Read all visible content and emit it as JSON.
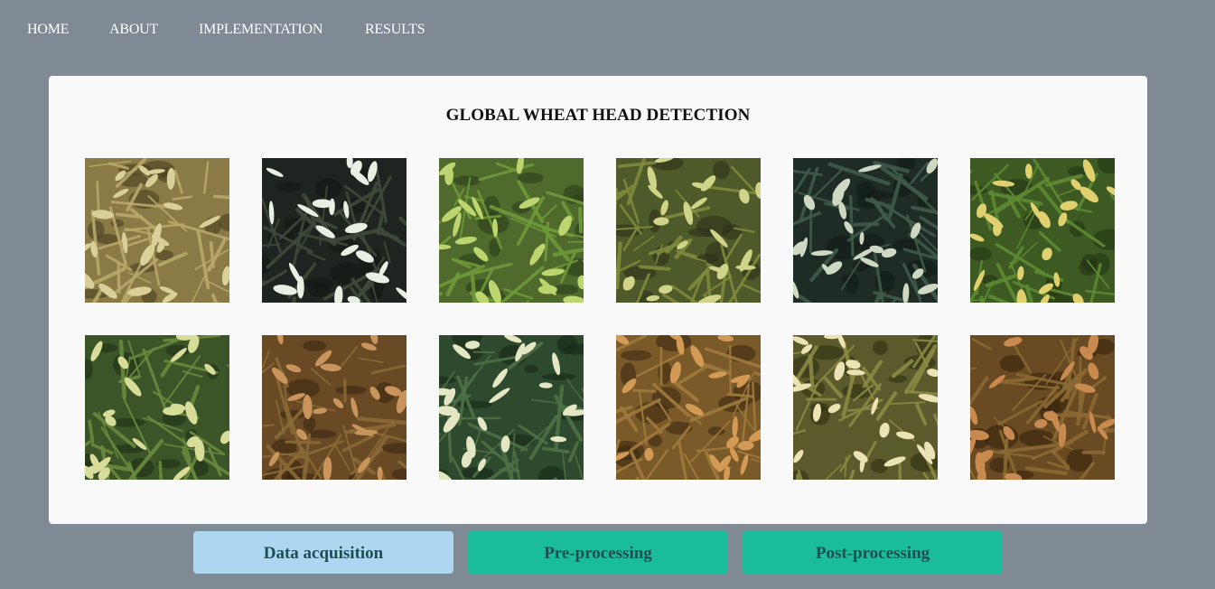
{
  "nav": {
    "items": [
      {
        "label": "HOME"
      },
      {
        "label": "ABOUT"
      },
      {
        "label": "IMPLEMENTATION"
      },
      {
        "label": "RESULTS"
      }
    ]
  },
  "card": {
    "title": "GLOBAL WHEAT HEAD DETECTION",
    "images": [
      {
        "name": "wheat-image-1",
        "bg": "#8a7a45",
        "blade": "#b8a86a",
        "head": "#d9cf98",
        "dark": "#4a3f22"
      },
      {
        "name": "wheat-image-2",
        "bg": "#1f2420",
        "blade": "#3f4a3a",
        "head": "#e8efe3",
        "dark": "#141714"
      },
      {
        "name": "wheat-image-3",
        "bg": "#4f6a2c",
        "blade": "#6f9a3a",
        "head": "#bcd56e",
        "dark": "#2d3d1a"
      },
      {
        "name": "wheat-image-4",
        "bg": "#4e5a2a",
        "blade": "#7f8a3c",
        "head": "#cfd488",
        "dark": "#2b301a"
      },
      {
        "name": "wheat-image-5",
        "bg": "#1f2c26",
        "blade": "#3f5a4a",
        "head": "#cfd8c0",
        "dark": "#121a16"
      },
      {
        "name": "wheat-image-6",
        "bg": "#3d5a22",
        "blade": "#5e8a33",
        "head": "#e0d070",
        "dark": "#233314"
      },
      {
        "name": "wheat-image-7",
        "bg": "#3b5428",
        "blade": "#6a8a3e",
        "head": "#d7dc98",
        "dark": "#202e15"
      },
      {
        "name": "wheat-image-8",
        "bg": "#6a4a25",
        "blade": "#8a6a36",
        "head": "#c9955c",
        "dark": "#3a2814"
      },
      {
        "name": "wheat-image-9",
        "bg": "#2e4a2e",
        "blade": "#4e7046",
        "head": "#e4e6c4",
        "dark": "#182818"
      },
      {
        "name": "wheat-image-10",
        "bg": "#7a5a28",
        "blade": "#a07a3c",
        "head": "#d29a55",
        "dark": "#3c2a12"
      },
      {
        "name": "wheat-image-11",
        "bg": "#5a5a2c",
        "blade": "#8a8a44",
        "head": "#ece3b4",
        "dark": "#2e2e14"
      },
      {
        "name": "wheat-image-12",
        "bg": "#6a4a22",
        "blade": "#8c6a34",
        "head": "#c88a4e",
        "dark": "#36240e"
      }
    ]
  },
  "buttons": [
    {
      "label": "Data acquisition",
      "color": "#aed6f1",
      "name": "data-acquisition-button"
    },
    {
      "label": "Pre-processing",
      "color": "#1abc9c",
      "name": "pre-processing-button"
    },
    {
      "label": "Post-processing",
      "color": "#1abc9c",
      "name": "post-processing-button"
    }
  ]
}
